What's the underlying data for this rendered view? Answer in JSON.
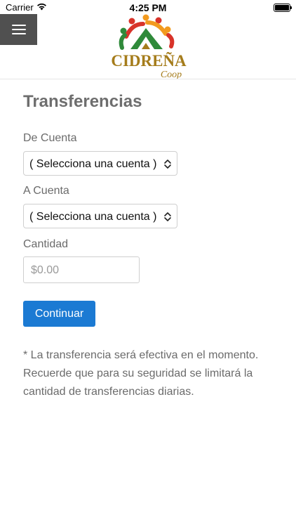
{
  "status_bar": {
    "carrier": "Carrier",
    "time": "4:25 PM"
  },
  "header": {
    "logo_text": "CIDREÑA",
    "logo_subtext": "Coop"
  },
  "main": {
    "title": "Transferencias",
    "from_account": {
      "label": "De Cuenta",
      "value": "( Selecciona una cuenta )"
    },
    "to_account": {
      "label": "A Cuenta",
      "value": "( Selecciona una cuenta )"
    },
    "amount": {
      "label": "Cantidad",
      "placeholder": "$0.00"
    },
    "continue_label": "Continuar",
    "note": "* La transferencia será efectiva en el momento. Recuerde que para su seguridad se limitará la cantidad de transferencias diarias."
  },
  "colors": {
    "accent": "#1b7ad3",
    "menu_bg": "#505050",
    "logo_gold": "#a57c1b",
    "logo_green": "#2f8a3a",
    "logo_red": "#d8332a",
    "logo_orange": "#f29a1f"
  },
  "icons": [
    "wifi-icon",
    "battery-icon",
    "hamburger-menu-icon",
    "select-chevron-icon"
  ]
}
